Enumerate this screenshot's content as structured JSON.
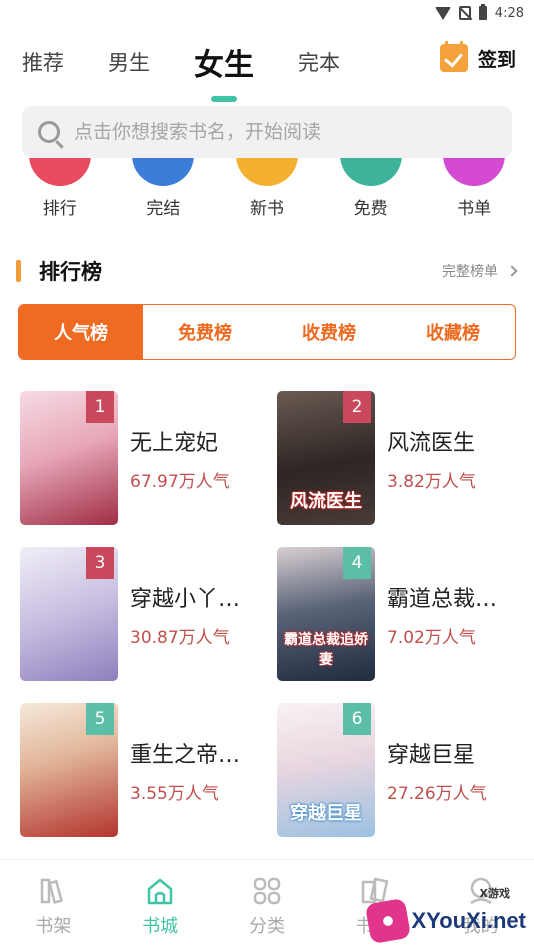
{
  "status_bar": {
    "time": "4:28"
  },
  "top_tabs": [
    {
      "label": "推荐"
    },
    {
      "label": "男生"
    },
    {
      "label": "女生"
    },
    {
      "label": "完本"
    }
  ],
  "active_top_tab": "女生",
  "signin": {
    "label": "签到",
    "icon": "calendar-check-icon",
    "color": "#f6a23c"
  },
  "search": {
    "placeholder": "点击你想搜索书名，开始阅读",
    "icon": "search-icon"
  },
  "categories": [
    {
      "label": "排行",
      "icon": "rank-icon",
      "color": "#e84a5f"
    },
    {
      "label": "完结",
      "icon": "finished-icon",
      "color": "#3b7dd8"
    },
    {
      "label": "新书",
      "icon": "new-book-icon",
      "color": "#f3b12f"
    },
    {
      "label": "免费",
      "icon": "free-icon",
      "color": "#3fb39a"
    },
    {
      "label": "书单",
      "icon": "booklist-icon",
      "color": "#d44bd1"
    }
  ],
  "ranking": {
    "title": "排行榜",
    "more": "完整榜单",
    "tabs": [
      {
        "label": "人气榜"
      },
      {
        "label": "免费榜"
      },
      {
        "label": "收费榜"
      },
      {
        "label": "收藏榜"
      }
    ],
    "active_tab": "人气榜",
    "accent": "#ee6b21",
    "books": [
      {
        "rank": "1",
        "title": "无上宠妃",
        "popularity": "67.97万人气",
        "cover_colors": [
          "#f3c6d3",
          "#b23a52"
        ]
      },
      {
        "rank": "2",
        "title": "风流医生",
        "popularity": "3.82万人气",
        "cover_colors": [
          "#3b3230",
          "#a8897a"
        ],
        "cover_text": "风流医生"
      },
      {
        "rank": "3",
        "title": "穿越小丫头的宝贝",
        "title_display": "穿越小丫…",
        "popularity": "30.87万人气",
        "cover_colors": [
          "#e9e4f2",
          "#9b8bc4"
        ]
      },
      {
        "rank": "4",
        "title": "霸道总裁追娇妻",
        "title_display": "霸道总裁…",
        "popularity": "7.02万人气",
        "cover_colors": [
          "#2a3b52",
          "#d8c5c8"
        ],
        "cover_text": "霸道总裁追娇妻"
      },
      {
        "rank": "5",
        "title": "重生之帝王宠妻",
        "title_display": "重生之帝…",
        "popularity": "3.55万人气",
        "cover_colors": [
          "#f4e4d4",
          "#b8302c"
        ]
      },
      {
        "rank": "6",
        "title": "穿越巨星",
        "popularity": "27.26万人气",
        "cover_colors": [
          "#f6eef2",
          "#a7c8e6"
        ],
        "cover_text": "穿越巨星"
      }
    ]
  },
  "bottom_nav": [
    {
      "label": "书架",
      "icon": "bookshelf-icon"
    },
    {
      "label": "书城",
      "icon": "bookstore-icon"
    },
    {
      "label": "分类",
      "icon": "category-grid-icon"
    },
    {
      "label": "书库",
      "icon": "library-icon"
    },
    {
      "label": "我的",
      "icon": "profile-icon"
    }
  ],
  "active_nav": "书城",
  "watermark": {
    "text": "XYouXi.net",
    "small": "X游戏"
  }
}
